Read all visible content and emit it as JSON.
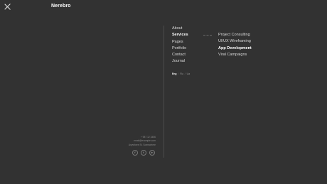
{
  "header": {
    "logo": "Nerebro",
    "close_icon": "close-icon"
  },
  "menu": {
    "items": [
      {
        "label": "About"
      },
      {
        "label": "Services"
      },
      {
        "label": "Pages"
      },
      {
        "label": "Portfolio"
      },
      {
        "label": "Contact"
      },
      {
        "label": "Journal"
      }
    ],
    "active_index": 1
  },
  "submenu": {
    "items": [
      {
        "label": "Project Consulting"
      },
      {
        "label": "UI/UX Wireframing"
      },
      {
        "label": "App Development"
      },
      {
        "label": "Viral Campaigns"
      }
    ],
    "active_index": 2
  },
  "languages": {
    "items": [
      "Eng",
      "Ru",
      "Ua"
    ],
    "separator": "/",
    "current": "Eng"
  },
  "contacts": {
    "lines": [
      "+ 987 12 3456",
      "email@example.com",
      "Anywhere St. Somewhere"
    ]
  },
  "social": {
    "items": [
      {
        "icon": "facebook-icon",
        "glyph": "f"
      },
      {
        "icon": "twitter-icon",
        "glyph": "t"
      },
      {
        "icon": "instagram-icon",
        "glyph": "in"
      }
    ]
  },
  "colors": {
    "background": "#323232",
    "text": "#ffffff",
    "muted": "#8a8a8a"
  }
}
